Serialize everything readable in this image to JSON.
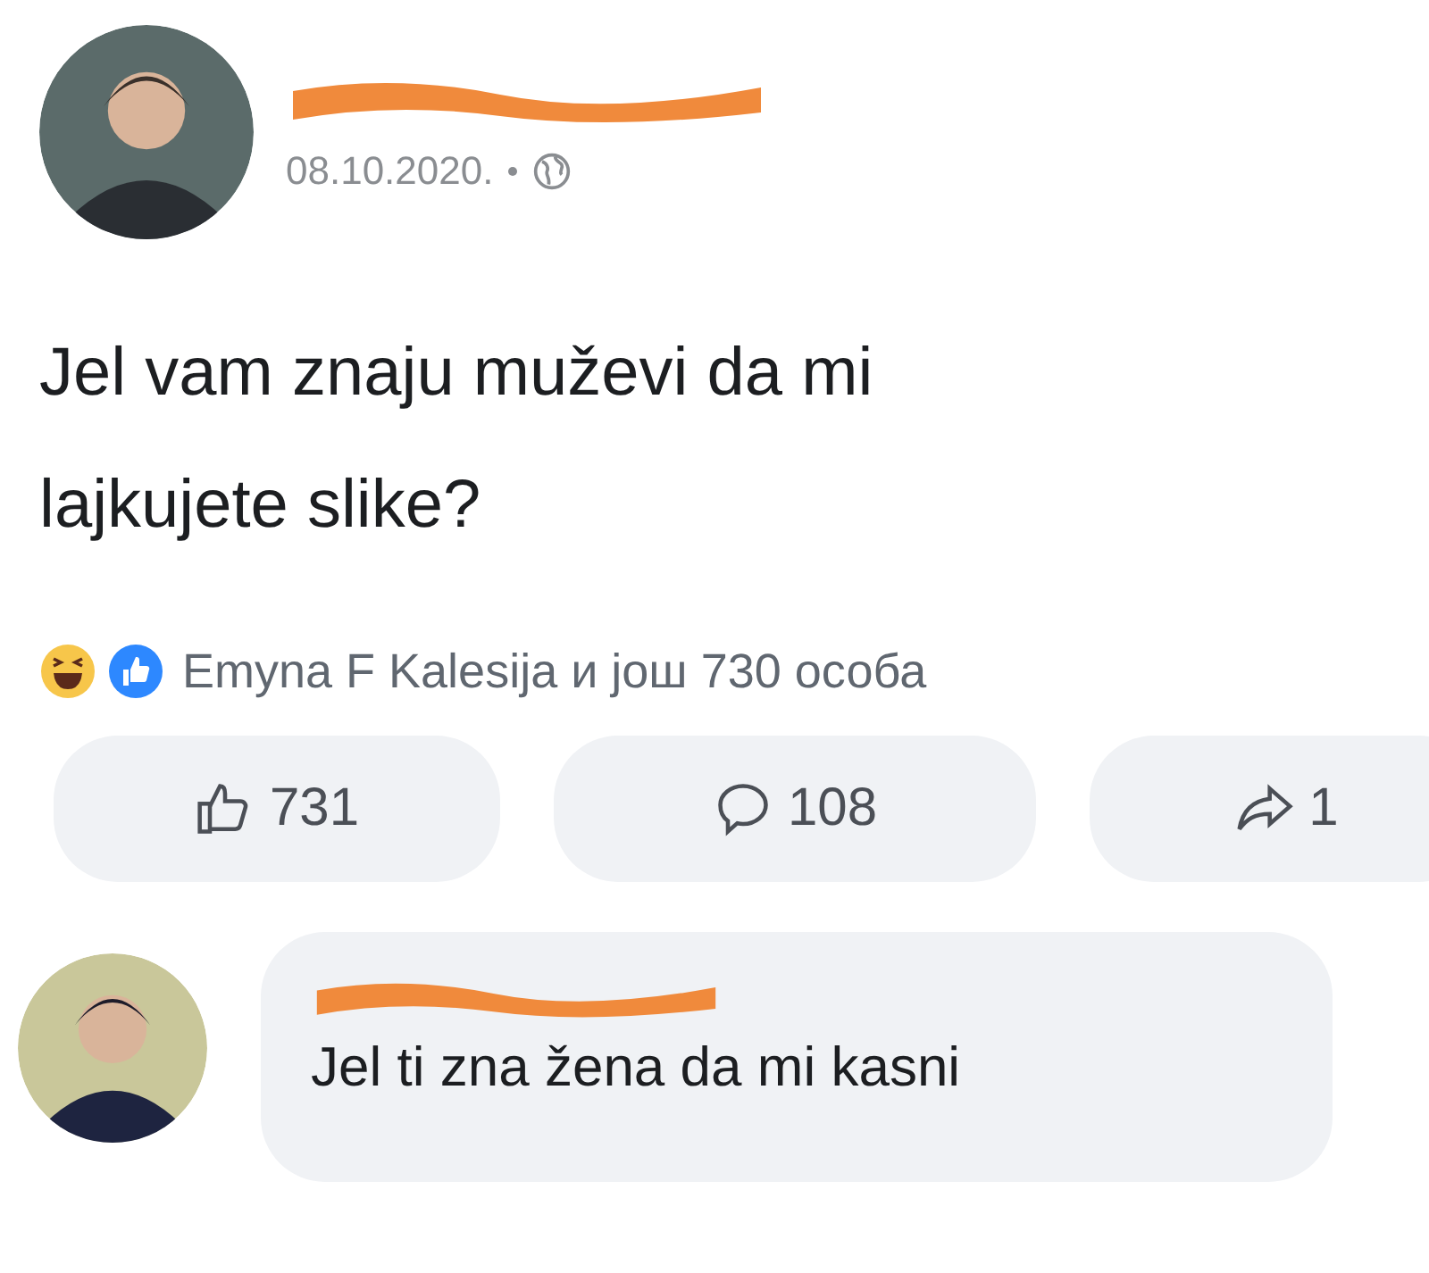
{
  "post": {
    "date": "08.10.2020.",
    "text": "Jel vam znaju muževi da mi lajkujete slike?"
  },
  "reactions": {
    "summary": "Emyna F Kalesija и још 730 особа"
  },
  "actions": [
    {
      "kind": "like",
      "count": "731"
    },
    {
      "kind": "comment",
      "count": "108"
    },
    {
      "kind": "share",
      "count": "1"
    }
  ],
  "comment": {
    "text": "Jel ti zna žena da mi kasni"
  }
}
